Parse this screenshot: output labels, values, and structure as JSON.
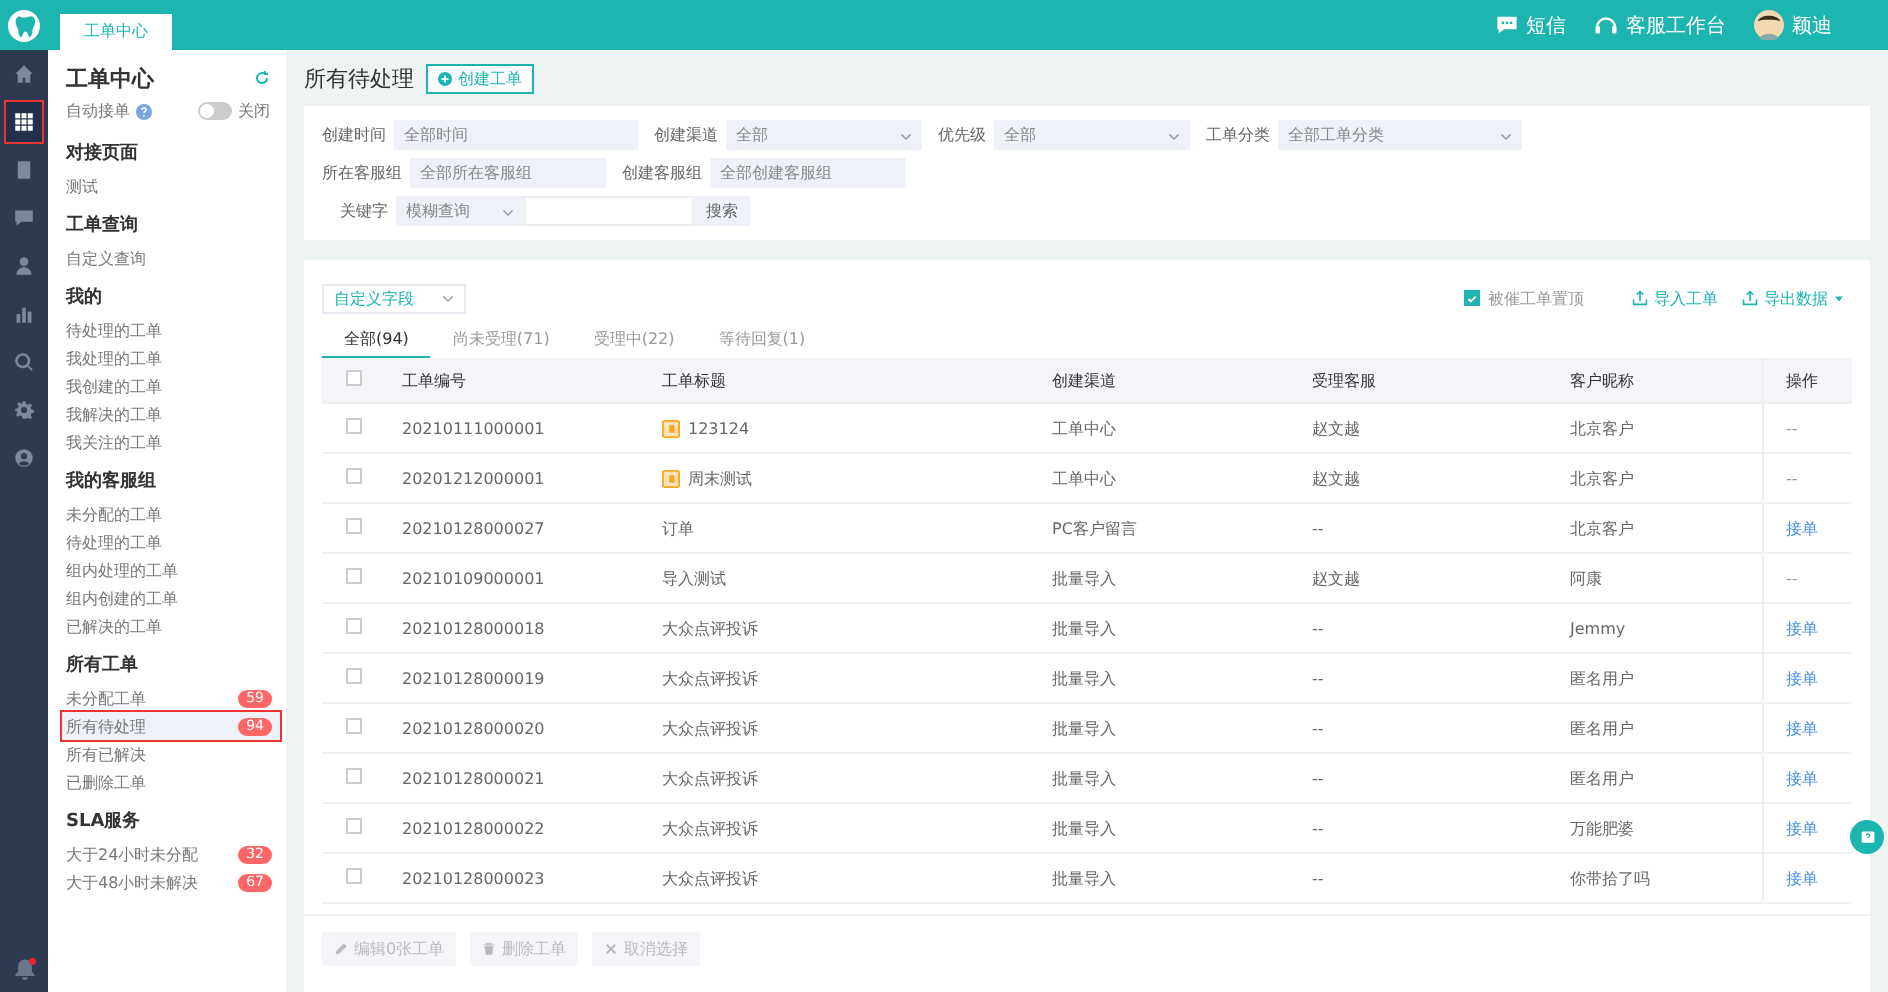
{
  "top_bar": {
    "tab": "工单中心",
    "actions": [
      {
        "kind": "sms",
        "label": "短信"
      },
      {
        "kind": "workbench",
        "label": "客服工作台"
      }
    ],
    "user": "颖迪"
  },
  "rail": [
    {
      "kind": "home",
      "selected": false
    },
    {
      "kind": "grid",
      "selected": true
    },
    {
      "kind": "doc",
      "selected": false
    },
    {
      "kind": "chat",
      "selected": false
    },
    {
      "kind": "user",
      "selected": false
    },
    {
      "kind": "chart",
      "selected": false
    },
    {
      "kind": "search",
      "selected": false
    },
    {
      "kind": "gear",
      "selected": false
    },
    {
      "kind": "person",
      "selected": false
    }
  ],
  "rail_bell": {
    "unread": true
  },
  "nav": {
    "title": "工单中心",
    "auto_accept": {
      "label": "自动接单",
      "on": false,
      "state_text": "关闭"
    },
    "sections": [
      {
        "title": "对接页面",
        "items": [
          {
            "label": "测试",
            "selected": false
          }
        ]
      },
      {
        "title": "工单查询",
        "items": [
          {
            "label": "自定义查询",
            "selected": false
          }
        ]
      },
      {
        "title": "我的",
        "items": [
          {
            "label": "待处理的工单",
            "selected": false
          },
          {
            "label": "我处理的工单",
            "selected": false
          },
          {
            "label": "我创建的工单",
            "selected": false
          },
          {
            "label": "我解决的工单",
            "selected": false
          },
          {
            "label": "我关注的工单",
            "selected": false
          }
        ]
      },
      {
        "title": "我的客服组",
        "items": [
          {
            "label": "未分配的工单",
            "selected": false
          },
          {
            "label": "待处理的工单",
            "selected": false
          },
          {
            "label": "组内处理的工单",
            "selected": false
          },
          {
            "label": "组内创建的工单",
            "selected": false
          },
          {
            "label": "已解决的工单",
            "selected": false
          }
        ]
      },
      {
        "title": "所有工单",
        "items": [
          {
            "label": "未分配工单",
            "selected": false,
            "badge": "59"
          },
          {
            "label": "所有待处理",
            "selected": true,
            "badge": "94"
          },
          {
            "label": "所有已解决",
            "selected": false
          },
          {
            "label": "已删除工单",
            "selected": false
          }
        ]
      },
      {
        "title": "SLA服务",
        "items": [
          {
            "label": "大于24小时未分配",
            "selected": false,
            "badge": "32"
          },
          {
            "label": "大于48小时未解决",
            "selected": false,
            "badge": "67"
          }
        ]
      }
    ]
  },
  "page": {
    "title": "所有待处理",
    "create_button": "创建工单"
  },
  "filters": {
    "rows": [
      [
        {
          "label": "创建时间",
          "value": "全部时间",
          "dropdown": false
        },
        {
          "label": "创建渠道",
          "value": "全部",
          "dropdown": true
        },
        {
          "label": "优先级",
          "value": "全部",
          "dropdown": true
        },
        {
          "label": "工单分类",
          "value": "全部工单分类",
          "dropdown": true
        }
      ],
      [
        {
          "label": "所在客服组",
          "value": "全部所在客服组",
          "dropdown": false
        },
        {
          "label": "创建客服组",
          "value": "全部创建客服组",
          "dropdown": false
        }
      ]
    ],
    "keyword": {
      "label": "关键字",
      "mode": "模糊查询",
      "button": "搜索"
    }
  },
  "toolbar": {
    "custom_fields": "自定义字段",
    "pin_urged": {
      "label": "被催工单置顶",
      "checked": true
    },
    "import": "导入工单",
    "export": "导出数据"
  },
  "tabs": [
    {
      "label": "全部(94)",
      "selected": true
    },
    {
      "label": "尚未受理(71)",
      "selected": false
    },
    {
      "label": "受理中(22)",
      "selected": false
    },
    {
      "label": "等待回复(1)",
      "selected": false
    }
  ],
  "table": {
    "all_selected": false,
    "columns": [
      "工单编号",
      "工单标题",
      "创建渠道",
      "受理客服",
      "客户昵称",
      "操作"
    ],
    "rows": [
      {
        "selected": false,
        "id": "20210111000001",
        "title": "123124",
        "flagged": true,
        "channel": "工单中心",
        "agent": "赵文越",
        "customer": "北京客户",
        "action": "--",
        "action_link": false
      },
      {
        "selected": false,
        "id": "20201212000001",
        "title": "周末测试",
        "flagged": true,
        "channel": "工单中心",
        "agent": "赵文越",
        "customer": "北京客户",
        "action": "--",
        "action_link": false
      },
      {
        "selected": false,
        "id": "20210128000027",
        "title": "订单",
        "flagged": false,
        "channel": "PC客户留言",
        "agent": "--",
        "customer": "北京客户",
        "action": "接单",
        "action_link": true
      },
      {
        "selected": false,
        "id": "20210109000001",
        "title": "导入测试",
        "flagged": false,
        "channel": "批量导入",
        "agent": "赵文越",
        "customer": "阿康",
        "action": "--",
        "action_link": false
      },
      {
        "selected": false,
        "id": "20210128000018",
        "title": "大众点评投诉",
        "flagged": false,
        "channel": "批量导入",
        "agent": "--",
        "customer": "Jemmy",
        "action": "接单",
        "action_link": true
      },
      {
        "selected": false,
        "id": "20210128000019",
        "title": "大众点评投诉",
        "flagged": false,
        "channel": "批量导入",
        "agent": "--",
        "customer": "匿名用户",
        "action": "接单",
        "action_link": true
      },
      {
        "selected": false,
        "id": "20210128000020",
        "title": "大众点评投诉",
        "flagged": false,
        "channel": "批量导入",
        "agent": "--",
        "customer": "匿名用户",
        "action": "接单",
        "action_link": true
      },
      {
        "selected": false,
        "id": "20210128000021",
        "title": "大众点评投诉",
        "flagged": false,
        "channel": "批量导入",
        "agent": "--",
        "customer": "匿名用户",
        "action": "接单",
        "action_link": true
      },
      {
        "selected": false,
        "id": "20210128000022",
        "title": "大众点评投诉",
        "flagged": false,
        "channel": "批量导入",
        "agent": "--",
        "customer": "万能肥婆",
        "action": "接单",
        "action_link": true
      },
      {
        "selected": false,
        "id": "20210128000023",
        "title": "大众点评投诉",
        "flagged": false,
        "channel": "批量导入",
        "agent": "--",
        "customer": "你带拾了吗",
        "action": "接单",
        "action_link": true
      }
    ]
  },
  "bulk_actions": [
    {
      "kind": "edit",
      "label": "编辑0张工单",
      "disabled": true
    },
    {
      "kind": "delete",
      "label": "删除工单",
      "disabled": true
    },
    {
      "kind": "cancel",
      "label": "取消选择",
      "disabled": true
    }
  ]
}
